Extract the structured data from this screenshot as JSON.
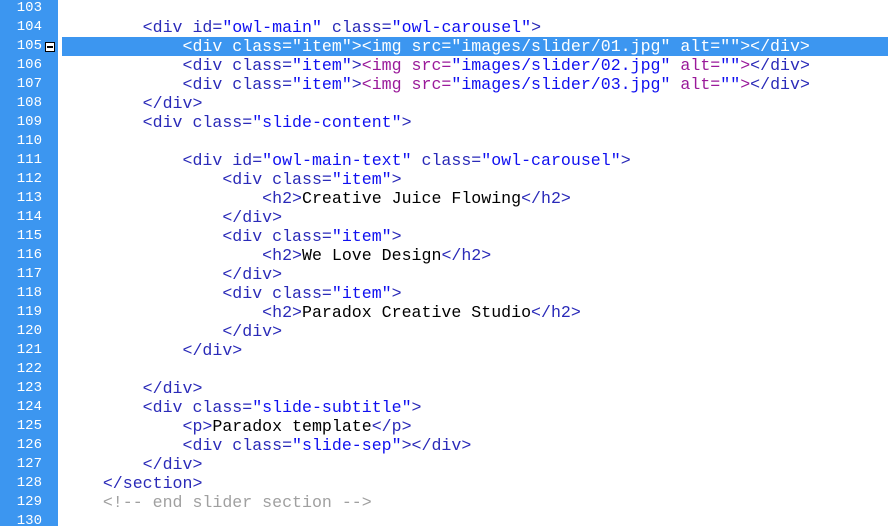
{
  "editor": {
    "highlighted_line": 105,
    "fold_marker_line": 105,
    "colors": {
      "gutter": "#3c96f0",
      "highlight": "#3c96f0",
      "tag": "#2a2ab8",
      "string": "#1010f0",
      "embedded": "#9a1a9a",
      "comment": "#a0a0a0"
    },
    "lines": [
      {
        "n": "103",
        "tokens": []
      },
      {
        "n": "104",
        "tokens": [
          [
            "x",
            "        "
          ],
          [
            "t",
            "<div id="
          ],
          [
            "s",
            "\"owl-main\""
          ],
          [
            "t",
            " class="
          ],
          [
            "s",
            "\"owl-carousel\""
          ],
          [
            "t",
            ">"
          ]
        ]
      },
      {
        "n": "105",
        "tokens": [
          [
            "x",
            "            "
          ],
          [
            "t",
            "<div class="
          ],
          [
            "s",
            "\"item\""
          ],
          [
            "t",
            "><img src="
          ],
          [
            "s",
            "\"images/slider/01.jpg\""
          ],
          [
            "t",
            " alt="
          ],
          [
            "s",
            "\"\""
          ],
          [
            "t",
            "></div>"
          ]
        ]
      },
      {
        "n": "106",
        "tokens": [
          [
            "x",
            "            "
          ],
          [
            "t",
            "<div class="
          ],
          [
            "s",
            "\"item\""
          ],
          [
            "t",
            ">"
          ],
          [
            "p",
            "<img src="
          ],
          [
            "s",
            "\"images/slider/02.jpg\""
          ],
          [
            "p",
            " alt="
          ],
          [
            "s",
            "\"\""
          ],
          [
            "p",
            ">"
          ],
          [
            "t",
            "</div>"
          ]
        ]
      },
      {
        "n": "107",
        "tokens": [
          [
            "x",
            "            "
          ],
          [
            "t",
            "<div class="
          ],
          [
            "s",
            "\"item\""
          ],
          [
            "t",
            ">"
          ],
          [
            "p",
            "<img src="
          ],
          [
            "s",
            "\"images/slider/03.jpg\""
          ],
          [
            "p",
            " alt="
          ],
          [
            "s",
            "\"\""
          ],
          [
            "p",
            ">"
          ],
          [
            "t",
            "</div>"
          ]
        ]
      },
      {
        "n": "108",
        "tokens": [
          [
            "x",
            "        "
          ],
          [
            "t",
            "</div>"
          ]
        ]
      },
      {
        "n": "109",
        "tokens": [
          [
            "x",
            "        "
          ],
          [
            "t",
            "<div class="
          ],
          [
            "s",
            "\"slide-content\""
          ],
          [
            "t",
            ">"
          ]
        ]
      },
      {
        "n": "110",
        "tokens": []
      },
      {
        "n": "111",
        "tokens": [
          [
            "x",
            "            "
          ],
          [
            "t",
            "<div id="
          ],
          [
            "s",
            "\"owl-main-text\""
          ],
          [
            "t",
            " class="
          ],
          [
            "s",
            "\"owl-carousel\""
          ],
          [
            "t",
            ">"
          ]
        ]
      },
      {
        "n": "112",
        "tokens": [
          [
            "x",
            "                "
          ],
          [
            "t",
            "<div class="
          ],
          [
            "s",
            "\"item\""
          ],
          [
            "t",
            ">"
          ]
        ]
      },
      {
        "n": "113",
        "tokens": [
          [
            "x",
            "                    "
          ],
          [
            "t",
            "<h2>"
          ],
          [
            "x",
            "Creative Juice Flowing"
          ],
          [
            "t",
            "</h2>"
          ]
        ]
      },
      {
        "n": "114",
        "tokens": [
          [
            "x",
            "                "
          ],
          [
            "t",
            "</div>"
          ]
        ]
      },
      {
        "n": "115",
        "tokens": [
          [
            "x",
            "                "
          ],
          [
            "t",
            "<div class="
          ],
          [
            "s",
            "\"item\""
          ],
          [
            "t",
            ">"
          ]
        ]
      },
      {
        "n": "116",
        "tokens": [
          [
            "x",
            "                    "
          ],
          [
            "t",
            "<h2>"
          ],
          [
            "x",
            "We Love Design"
          ],
          [
            "t",
            "</h2>"
          ]
        ]
      },
      {
        "n": "117",
        "tokens": [
          [
            "x",
            "                "
          ],
          [
            "t",
            "</div>"
          ]
        ]
      },
      {
        "n": "118",
        "tokens": [
          [
            "x",
            "                "
          ],
          [
            "t",
            "<div class="
          ],
          [
            "s",
            "\"item\""
          ],
          [
            "t",
            ">"
          ]
        ]
      },
      {
        "n": "119",
        "tokens": [
          [
            "x",
            "                    "
          ],
          [
            "t",
            "<h2>"
          ],
          [
            "x",
            "Paradox Creative Studio"
          ],
          [
            "t",
            "</h2>"
          ]
        ]
      },
      {
        "n": "120",
        "tokens": [
          [
            "x",
            "                "
          ],
          [
            "t",
            "</div>"
          ]
        ]
      },
      {
        "n": "121",
        "tokens": [
          [
            "x",
            "            "
          ],
          [
            "t",
            "</div>"
          ]
        ]
      },
      {
        "n": "122",
        "tokens": []
      },
      {
        "n": "123",
        "tokens": [
          [
            "x",
            "        "
          ],
          [
            "t",
            "</div>"
          ]
        ]
      },
      {
        "n": "124",
        "tokens": [
          [
            "x",
            "        "
          ],
          [
            "t",
            "<div class="
          ],
          [
            "s",
            "\"slide-subtitle\""
          ],
          [
            "t",
            ">"
          ]
        ]
      },
      {
        "n": "125",
        "tokens": [
          [
            "x",
            "            "
          ],
          [
            "t",
            "<p>"
          ],
          [
            "x",
            "Paradox template"
          ],
          [
            "t",
            "</p>"
          ]
        ]
      },
      {
        "n": "126",
        "tokens": [
          [
            "x",
            "            "
          ],
          [
            "t",
            "<div class="
          ],
          [
            "s",
            "\"slide-sep\""
          ],
          [
            "t",
            "></div>"
          ]
        ]
      },
      {
        "n": "127",
        "tokens": [
          [
            "x",
            "        "
          ],
          [
            "t",
            "</div>"
          ]
        ]
      },
      {
        "n": "128",
        "tokens": [
          [
            "x",
            "    "
          ],
          [
            "t",
            "</section>"
          ]
        ]
      },
      {
        "n": "129",
        "tokens": [
          [
            "x",
            "    "
          ],
          [
            "c",
            "<!-- end slider section -->"
          ]
        ]
      },
      {
        "n": "130",
        "tokens": []
      }
    ]
  }
}
